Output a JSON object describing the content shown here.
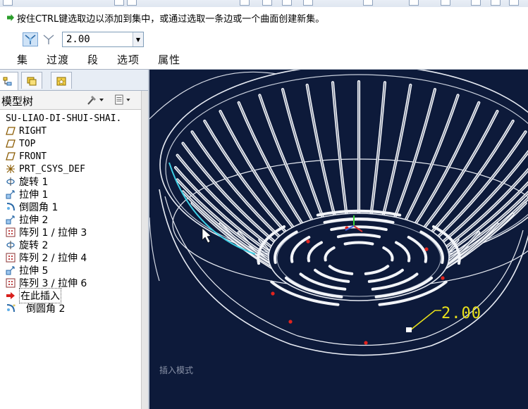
{
  "prompt": {
    "text": "按住CTRL键选取边以添加到集中，或通过选取一条边或一个曲面创建新集。"
  },
  "dashboard": {
    "value": "2.00",
    "tabs": [
      "集",
      "过渡",
      "段",
      "选项",
      "属性"
    ]
  },
  "navigator": {
    "title": "模型树",
    "tree": [
      {
        "label": "SU-LIAO-DI-SHUI-SHAI.",
        "icon": "part-icon"
      },
      {
        "label": "RIGHT",
        "icon": "datum-plane-icon"
      },
      {
        "label": "TOP",
        "icon": "datum-plane-icon"
      },
      {
        "label": "FRONT",
        "icon": "datum-plane-icon"
      },
      {
        "label": "PRT_CSYS_DEF",
        "icon": "csys-icon"
      },
      {
        "label": "旋转 1",
        "icon": "revolve-icon"
      },
      {
        "label": "拉伸 1",
        "icon": "extrude-icon"
      },
      {
        "label": "倒圆角 1",
        "icon": "round-icon"
      },
      {
        "label": "拉伸 2",
        "icon": "extrude-icon"
      },
      {
        "label": "阵列 1 / 拉伸 3",
        "icon": "pattern-icon"
      },
      {
        "label": "旋转 2",
        "icon": "revolve-icon"
      },
      {
        "label": "阵列 2 / 拉伸 4",
        "icon": "pattern-icon"
      },
      {
        "label": "拉伸 5",
        "icon": "extrude-icon"
      },
      {
        "label": "阵列 3 / 拉伸 6",
        "icon": "pattern-icon"
      },
      {
        "label": "在此插入",
        "icon": "insert-arrow-icon"
      },
      {
        "label": "倒圆角 2",
        "icon": "round-icon"
      }
    ]
  },
  "graphics": {
    "mode_label": "插入模式",
    "dimension": "2.00",
    "background": "#0d1a3a"
  }
}
